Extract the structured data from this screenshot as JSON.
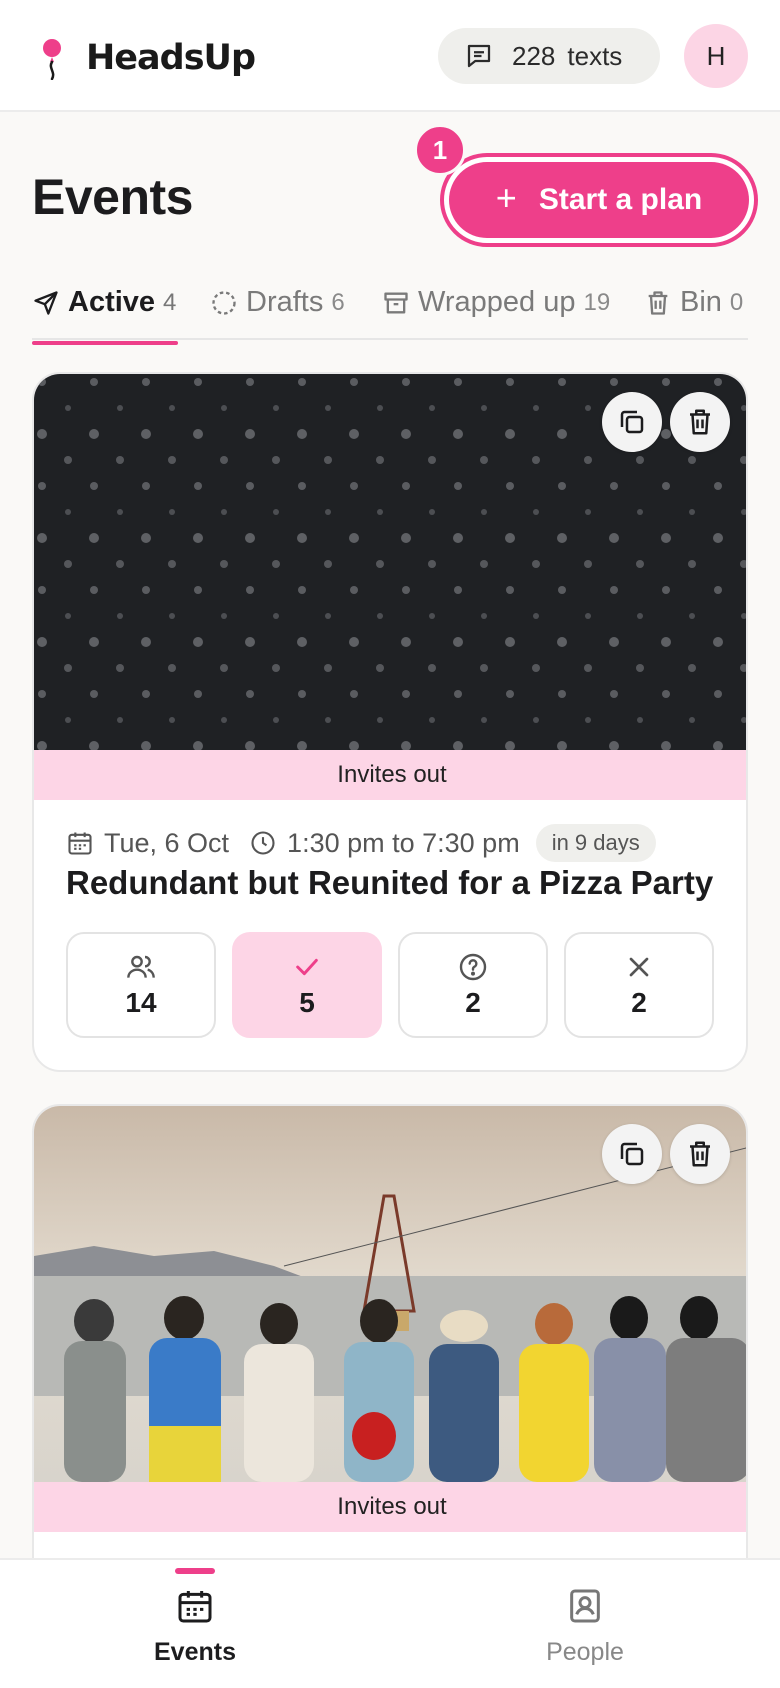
{
  "header": {
    "app_name": "HeadsUp",
    "texts_count": "228",
    "texts_label": "texts",
    "avatar_initial": "H"
  },
  "page": {
    "title": "Events",
    "start_plan_label": "Start a plan",
    "step_badge": "1"
  },
  "tabs": [
    {
      "label": "Active",
      "count": "4",
      "icon": "send-icon",
      "active": true
    },
    {
      "label": "Drafts",
      "count": "6",
      "icon": "dashed-circle-icon",
      "active": false
    },
    {
      "label": "Wrapped up",
      "count": "19",
      "icon": "archive-icon",
      "active": false
    },
    {
      "label": "Bin",
      "count": "0",
      "icon": "trash-icon",
      "active": false
    }
  ],
  "events": [
    {
      "status": "Invites out",
      "date": "Tue, 6 Oct",
      "time": "1:30 pm to 7:30 pm",
      "relative": "in 9 days",
      "title": "Redundant but Reunited for a Pizza Party",
      "stats": {
        "invited": "14",
        "going": "5",
        "maybe": "2",
        "declined": "2"
      },
      "image": "dark-polka-dot-pattern"
    },
    {
      "status": "Invites out",
      "image": "group-of-friends-seaside-photo"
    }
  ],
  "bottom_nav": [
    {
      "label": "Events",
      "icon": "calendar-icon",
      "active": true
    },
    {
      "label": "People",
      "icon": "contact-book-icon",
      "active": false
    }
  ],
  "colors": {
    "accent": "#ee3f8a",
    "accent_light": "#fdd5e6",
    "background": "#faf9f7"
  }
}
